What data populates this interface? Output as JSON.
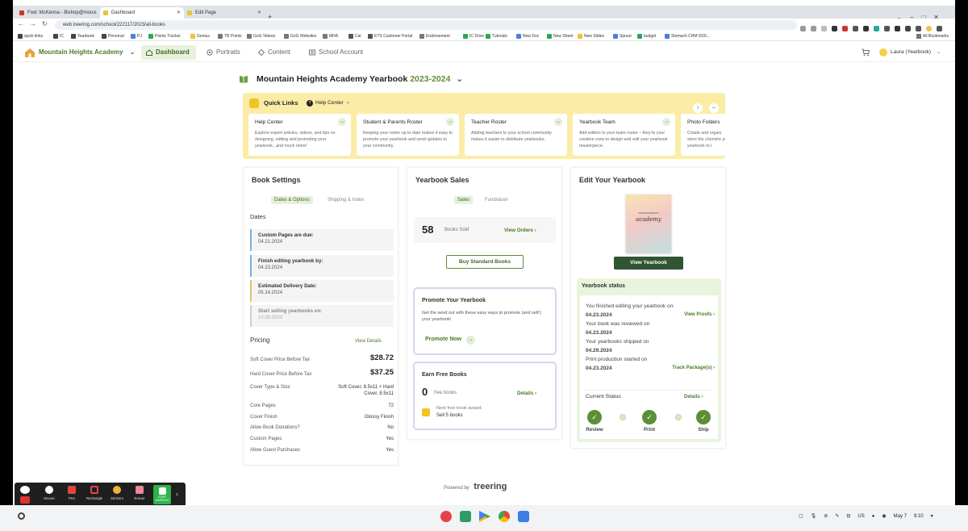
{
  "browser": {
    "tabs": [
      {
        "title": "Fwd: McKenna - Bishop@mou..."
      },
      {
        "title": "Dashboard"
      },
      {
        "title": "Edit Page"
      }
    ],
    "new_tab": "+",
    "url": "web.treering.com/school/222117/2023/all-books",
    "bookmarks": [
      "quick links",
      "IC",
      "Yearbook",
      "Personal",
      "PJ",
      "Points Tracker",
      "Genius",
      "TB Points",
      "GoG Videos",
      "GoG Websites",
      "MHA",
      "Cal",
      "ETS Customer Portal",
      "Endorsement",
      "IC Drive",
      "Tutorials",
      "New Doc",
      "New Sheet",
      "New Slides",
      "Sprout",
      "budget",
      "Stomach CHM 9/20..."
    ],
    "all_bookmarks": "All Bookmarks"
  },
  "appnav": {
    "school": "Mountain Heights Academy",
    "items": [
      {
        "label": "Dashboard"
      },
      {
        "label": "Portraits"
      },
      {
        "label": "Content"
      },
      {
        "label": "School Account"
      }
    ],
    "user": "Laura (Yearbook)"
  },
  "page": {
    "title": "Mountain Heights Academy Yearbook",
    "year": "2023-2024"
  },
  "quick_links": {
    "label": "Quick Links",
    "help": "Help Center",
    "cards": [
      {
        "title": "Help Center",
        "desc": "Explore expert articles, videos, and tips on designing, editing and promoting your yearbook...and much more!"
      },
      {
        "title": "Student & Parents Roster",
        "desc": "Keeping your roster up to date makes it easy to promote your yearbook and send updates to your community."
      },
      {
        "title": "Teacher Roster",
        "desc": "Adding teachers to your school community makes it easier to distribute yearbooks."
      },
      {
        "title": "Yearbook Team",
        "desc": "Add editors to your team roster – they're your creative crew to design and edit your yearbook masterpiece."
      },
      {
        "title": "Photo Folders",
        "desc": "Create and organi store the cherishe your yearbook to l"
      }
    ]
  },
  "book_settings": {
    "title": "Book Settings",
    "tabs": [
      "Dates & Options",
      "Shipping & Index"
    ],
    "dates_label": "Dates",
    "dates": [
      {
        "title": "Custom Pages are due:",
        "value": "04.21.2024",
        "color": "#7bb0d8"
      },
      {
        "title": "Finish editing yearbook by:",
        "value": "04.23.2024",
        "color": "#7bb0d8"
      },
      {
        "title": "Estimated Delivery Date:",
        "value": "05.14.2024",
        "color": "#d8c86a"
      },
      {
        "title": "Start selling yearbooks on:",
        "value": "10.09.2023",
        "color": "#cfcfcf"
      }
    ],
    "pricing_label": "Pricing",
    "view_details": "View Details",
    "pricing": [
      {
        "label": "Soft Cover Price Before Tax",
        "value": "$28.72"
      },
      {
        "label": "Hard Cover Price Before Tax",
        "value": "$37.25"
      },
      {
        "label": "Cover Type & Size",
        "value": "Soft Cover, 8.5x11 + Hard Cover, 8.5x11"
      },
      {
        "label": "Core Pages",
        "value": "72"
      },
      {
        "label": "Cover Finish",
        "value": "Glossy Finish"
      },
      {
        "label": "Allow Book Donations?",
        "value": "No"
      },
      {
        "label": "Custom Pages",
        "value": "Yes"
      },
      {
        "label": "Allow Guest Purchases",
        "value": "Yes"
      }
    ]
  },
  "sales": {
    "title": "Yearbook Sales",
    "tabs": [
      "Sales",
      "Fundraiser"
    ],
    "books_sold": "58",
    "books_sold_label": "Books Sold",
    "view_orders": "View Orders",
    "buy_button": "Buy Standard Books",
    "promote": {
      "title": "Promote Your Yearbook",
      "desc": "Get the word out with these easy ways to promote (and sell!) your yearbook!",
      "cta": "Promote Now"
    },
    "free": {
      "title": "Earn Free Books",
      "count": "0",
      "count_label": "free books",
      "details": "Details",
      "next_label": "Next free book award:",
      "next_value": "Sell 5 books"
    }
  },
  "edit": {
    "title": "Edit Your Yearbook",
    "cover_small": "MOUNTAIN HEIGHTS",
    "cover_title": "academy",
    "view_button": "View Yearbook",
    "status_title": "Yearbook status",
    "status_lines": [
      {
        "text": "You finished editing your yearbook on:",
        "date": "04.23.2024",
        "link": "View Proofs"
      },
      {
        "text": "Your book was reviewed on",
        "date": "04.23.2024",
        "link": ""
      },
      {
        "text": "Your yearbooks shipped on",
        "date": "04.29.2024",
        "link": ""
      },
      {
        "text": "Print production started on",
        "date": "04.23.2024",
        "link": "Track Package(s)"
      }
    ],
    "current_status": "Current Status",
    "details": "Details",
    "steps": [
      "Review",
      "Print",
      "Ship"
    ]
  },
  "footer": {
    "powered_by": "Powered by",
    "brand": "treering"
  },
  "zoom_toolbar": [
    "Mouse",
    "Pen",
    "Rectangle",
    "Stickers",
    "Eraser",
    "START WORKING"
  ],
  "tray": {
    "locale": "US",
    "date": "May 7",
    "time": "9:10"
  }
}
